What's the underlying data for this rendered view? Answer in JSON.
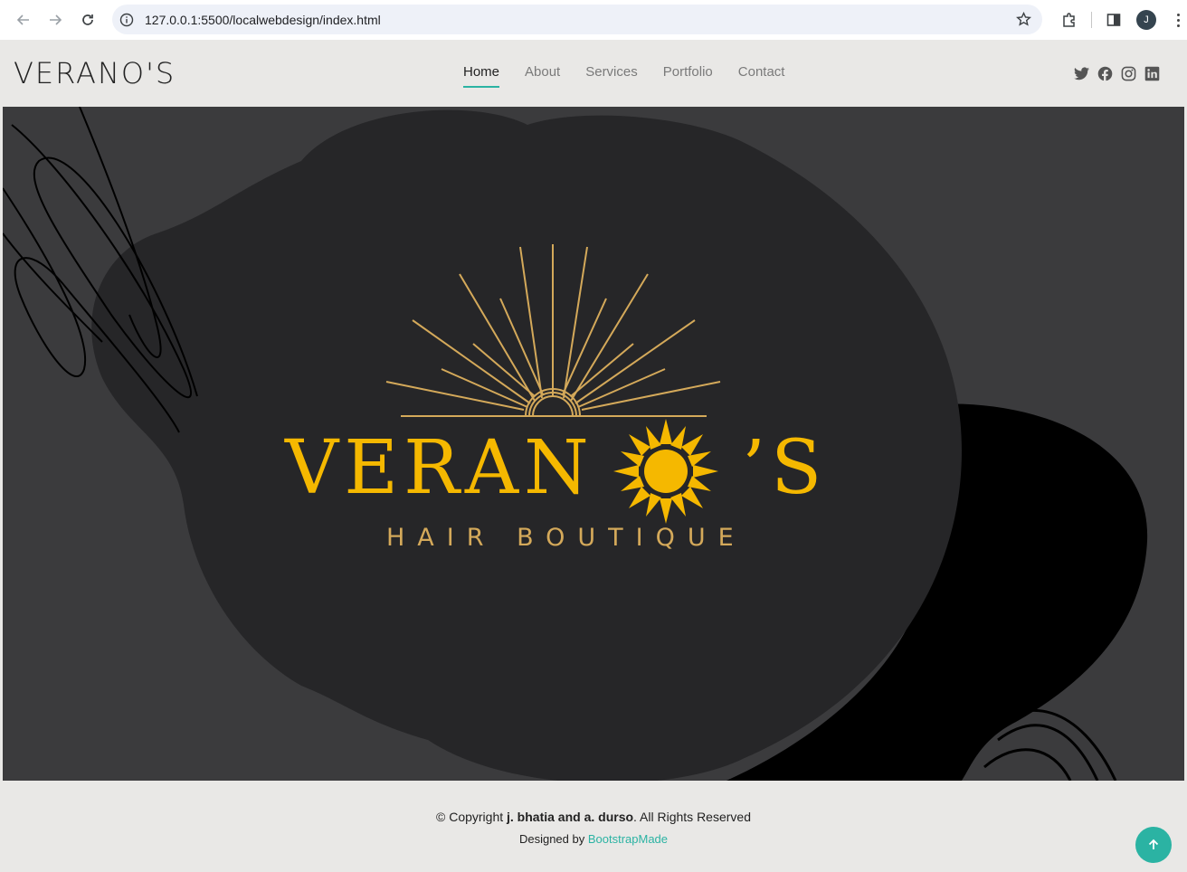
{
  "browser": {
    "url": "127.0.0.1:5500/localwebdesign/index.html",
    "profile_initial": "J"
  },
  "header": {
    "logo": "VERANO'S",
    "nav": [
      {
        "label": "Home",
        "active": true
      },
      {
        "label": "About",
        "active": false
      },
      {
        "label": "Services",
        "active": false
      },
      {
        "label": "Portfolio",
        "active": false
      },
      {
        "label": "Contact",
        "active": false
      }
    ],
    "socials": [
      "twitter-icon",
      "facebook-icon",
      "instagram-icon",
      "linkedin-icon"
    ]
  },
  "hero": {
    "brand_name": "VERAN",
    "brand_suffix": "’S",
    "tagline": "HAIR BOUTIQUE"
  },
  "footer": {
    "copyright_prefix": "© Copyright ",
    "copyright_owner": "j. bhatia and a. durso",
    "copyright_suffix": ". All Rights Reserved",
    "designed_by_prefix": "Designed by ",
    "designed_by_link": "BootstrapMade"
  },
  "colors": {
    "accent": "#2bb3a3",
    "gold": "#f5b800",
    "gold_light": "#d4a95a",
    "hero_bg": "#3b3b3d",
    "blob": "#262628"
  }
}
